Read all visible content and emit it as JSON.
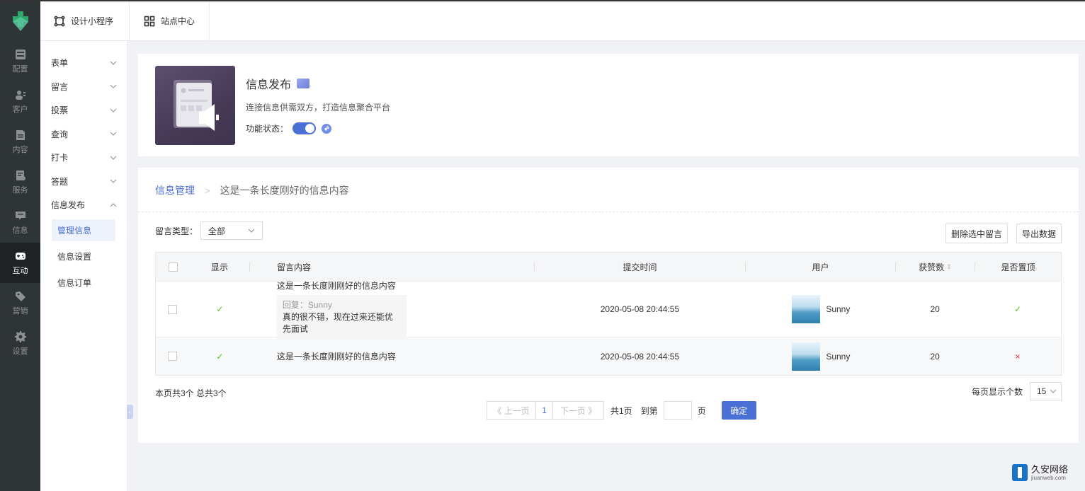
{
  "rail": {
    "items": [
      {
        "label": "配置",
        "icon": "config-icon"
      },
      {
        "label": "客户",
        "icon": "customer-icon"
      },
      {
        "label": "内容",
        "icon": "content-icon"
      },
      {
        "label": "服务",
        "icon": "service-icon"
      },
      {
        "label": "信息",
        "icon": "info-icon"
      },
      {
        "label": "互动",
        "icon": "gamepad-icon",
        "active": true
      },
      {
        "label": "营销",
        "icon": "tag-icon"
      },
      {
        "label": "设置",
        "icon": "gear-icon"
      }
    ]
  },
  "header": {
    "tabs": [
      {
        "label": "设计小程序",
        "icon": "design-icon"
      },
      {
        "label": "站点中心",
        "icon": "grid-icon"
      }
    ]
  },
  "submenu": {
    "groups": [
      "表单",
      "留言",
      "投票",
      "查询",
      "打卡",
      "答题",
      "信息发布"
    ],
    "subitems": [
      "管理信息",
      "信息设置",
      "信息订单"
    ],
    "active_sub": "管理信息"
  },
  "feature": {
    "title": "信息发布",
    "desc": "连接信息供需双方，打造信息聚合平台",
    "status_label": "功能状态：",
    "enabled": true
  },
  "breadcrumb": {
    "root": "信息管理",
    "current": "这是一条长度刚好的信息内容"
  },
  "filter": {
    "label": "留言类型：",
    "value": "全部"
  },
  "actions": {
    "delete_label": "删除选中留言",
    "export_label": "导出数据"
  },
  "table": {
    "headers": {
      "show": "显示",
      "content": "留言内容",
      "time": "提交时间",
      "user": "用户",
      "likes": "获赞数",
      "top": "是否置顶"
    },
    "rows": [
      {
        "content": "这是一条长度刚刚好的信息内容",
        "reply_title": "回复：Sunny",
        "reply_text": "真的很不错，现在过来还能优先面试",
        "time": "2020-05-08 20:44:55",
        "user": "Sunny",
        "likes": "20",
        "shown": "✓",
        "top": "✓"
      },
      {
        "content": "这是一条长度刚刚好的信息内容",
        "time": "2020-05-08 20:44:55",
        "user": "Sunny",
        "likes": "20",
        "shown": "✓",
        "top": "×"
      }
    ]
  },
  "pagination": {
    "summary": "本页共3个  总共3个",
    "prev": "《 上一页",
    "page": "1",
    "next": "下一页 》",
    "total_pages": "共1页",
    "goto_label": "到第",
    "page_unit": "页",
    "confirm": "确定",
    "per_page_label": "每页显示个数",
    "per_page_value": "15"
  },
  "watermark": {
    "name": "久安网络",
    "domain": "jiuanweb.com"
  },
  "colors": {
    "primary": "#4a6fd5",
    "rail_bg": "#2f3437",
    "success": "#52c41a",
    "danger": "#f5222d"
  }
}
